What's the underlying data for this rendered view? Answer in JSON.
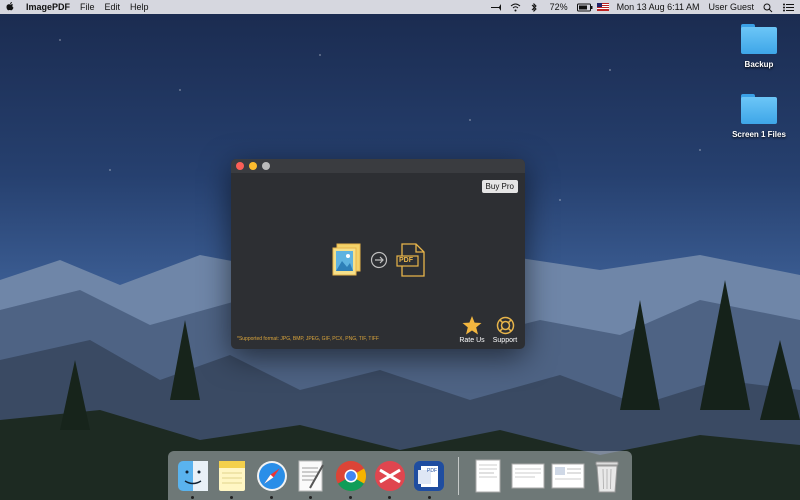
{
  "menubar": {
    "app_name": "ImagePDF",
    "menus": [
      "File",
      "Edit",
      "Help"
    ],
    "battery": "72%",
    "datetime": "Mon 13 Aug  6:11 AM",
    "user": "User Guest"
  },
  "desktop": {
    "icons": [
      {
        "label": "Backup"
      },
      {
        "label": "Screen 1 Files"
      }
    ]
  },
  "window": {
    "buy_label": "Buy Pro",
    "supported": "*Supported format: JPG, BMP, JPEG, GIF, PCX, PNG, TIF, TIFF",
    "pdf_label": "PDF",
    "rate_label": "Rate Us",
    "support_label": "Support",
    "accent": "#e8b54a"
  },
  "dock": {
    "apps": [
      "finder-icon",
      "notes-icon",
      "safari-icon",
      "textedit-icon",
      "chrome-icon",
      "skitch-icon",
      "imagepdf-icon"
    ],
    "docs": [
      "document-thumbnail-icon",
      "document-thumbnail-icon",
      "document-thumbnail-icon",
      "trash-icon"
    ]
  }
}
